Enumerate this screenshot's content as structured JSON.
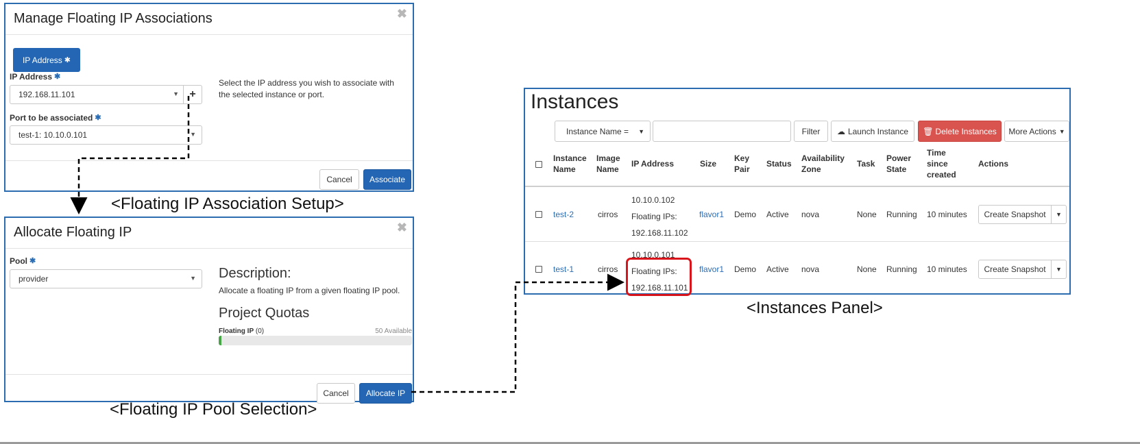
{
  "manage_modal": {
    "title": "Manage Floating IP Associations",
    "close": "✖",
    "tab_label": "IP Address",
    "ip_label": "IP Address",
    "ip_value": "192.168.11.101",
    "add_icon": "+",
    "port_label": "Port to be associated",
    "port_value": "test-1: 10.10.0.101",
    "help_text": "Select the IP address you wish to associate with the selected instance or port.",
    "cancel": "Cancel",
    "associate": "Associate"
  },
  "allocate_modal": {
    "title": "Allocate Floating IP",
    "close": "✖",
    "pool_label": "Pool",
    "pool_value": "provider",
    "description_heading": "Description:",
    "description_text": "Allocate a floating IP from a given floating IP pool.",
    "quotas_heading": "Project Quotas",
    "quota_label": "Floating IP",
    "quota_count": "(0)",
    "quota_available": "50 Available",
    "quota_fraction": 0.01,
    "cancel": "Cancel",
    "allocate": "Allocate IP"
  },
  "captions": {
    "association": "<Floating IP Association Setup>",
    "pool": "<Floating IP Pool Selection>",
    "instances": "<Instances Panel>"
  },
  "instances": {
    "title": "Instances",
    "filter_select": "Instance Name =",
    "filter_btn": "Filter",
    "launch_btn": "Launch Instance",
    "delete_btn": "Delete Instances",
    "more_btn": "More Actions",
    "headers": {
      "name": [
        "Instance",
        "Name"
      ],
      "image": [
        "Image",
        "Name"
      ],
      "ip": "IP Address",
      "size": "Size",
      "key": [
        "Key",
        "Pair"
      ],
      "status": "Status",
      "zone": [
        "Availability",
        "Zone"
      ],
      "task": "Task",
      "power": [
        "Power",
        "State"
      ],
      "time": [
        "Time",
        "since",
        "created"
      ],
      "actions": "Actions"
    },
    "rows": [
      {
        "name": "test-2",
        "image": "cirros",
        "ip_lines": [
          "10.10.0.102",
          "Floating IPs:",
          "192.168.11.102"
        ],
        "size": "flavor1",
        "key": "Demo",
        "status": "Active",
        "zone": "nova",
        "task": "None",
        "power": "Running",
        "time": "10 minutes",
        "action": "Create Snapshot"
      },
      {
        "name": "test-1",
        "image": "cirros",
        "ip_lines": [
          "10.10.0.101",
          "Floating IPs:",
          "192.168.11.101"
        ],
        "size": "flavor1",
        "key": "Demo",
        "status": "Active",
        "zone": "nova",
        "task": "None",
        "power": "Running",
        "time": "10 minutes",
        "action": "Create Snapshot"
      }
    ]
  },
  "colors": {
    "primary": "#2466b4",
    "danger": "#d9534f",
    "highlight": "#d9141a",
    "link": "#2a6db5"
  }
}
